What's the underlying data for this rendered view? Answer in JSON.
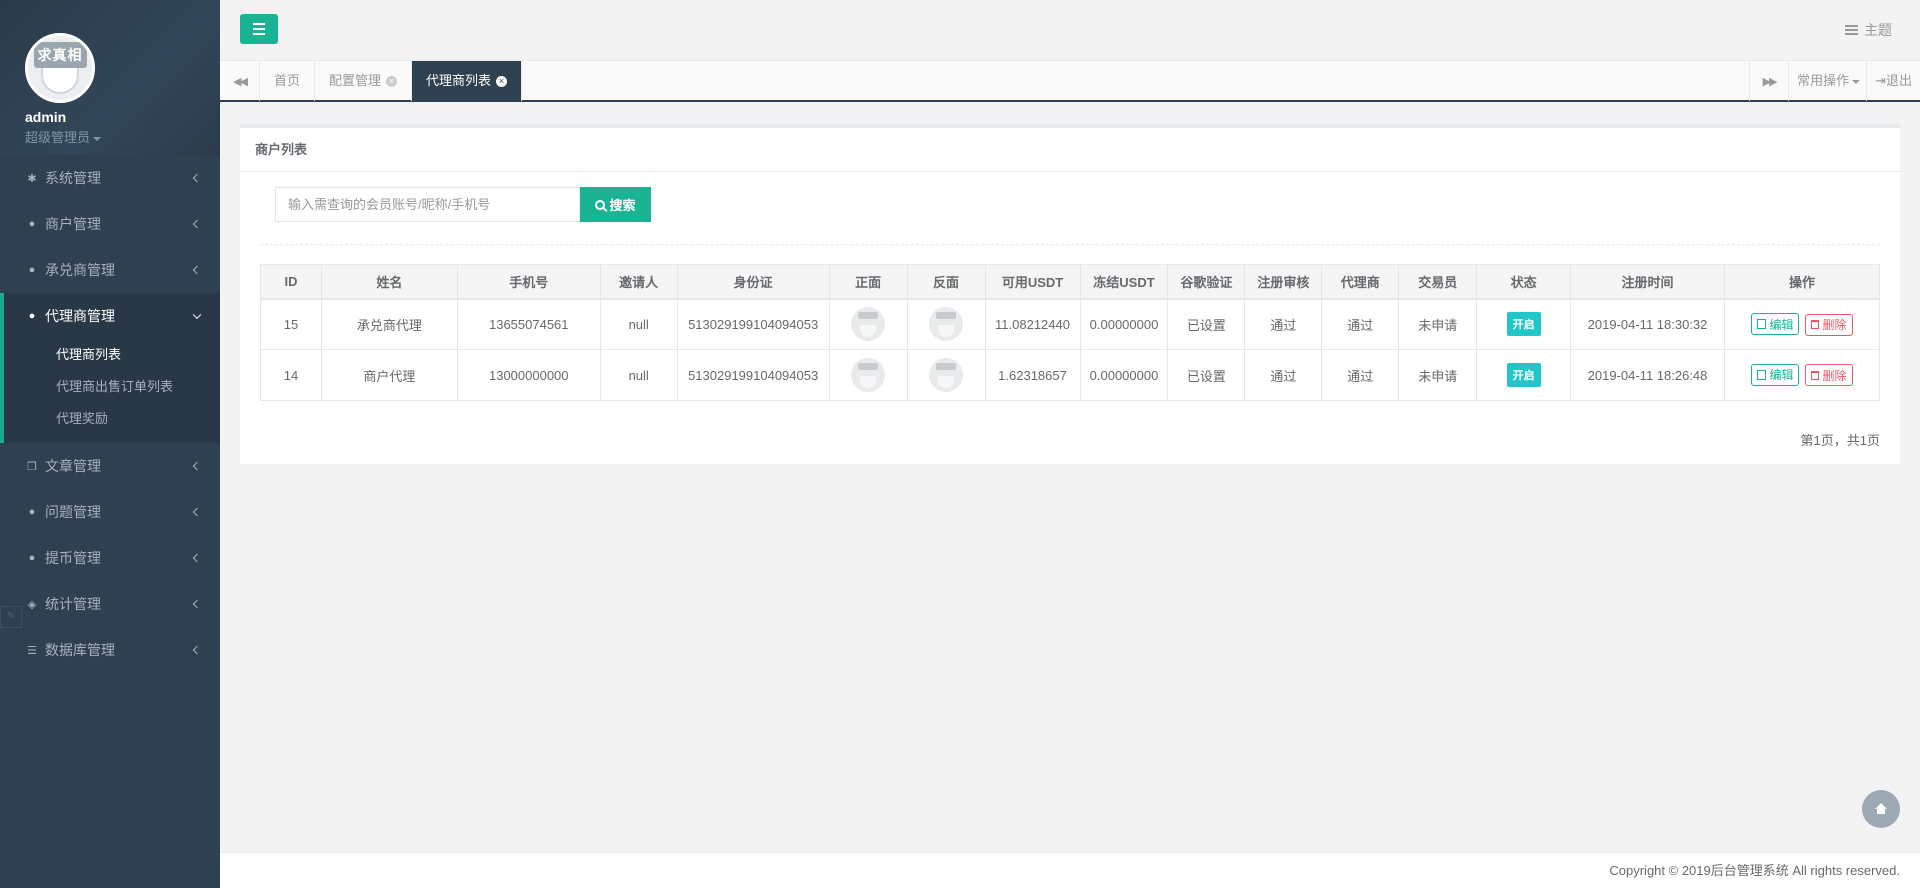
{
  "profile": {
    "avatar_text": "求真相",
    "name": "admin",
    "role": "超级管理员"
  },
  "menu": {
    "system": "系统管理",
    "merchant": "商户管理",
    "acceptor": "承兑商管理",
    "agent": "代理商管理",
    "agent_sub": [
      "代理商列表",
      "代理商出售订单列表",
      "代理奖励"
    ],
    "article": "文章管理",
    "question": "问题管理",
    "withdraw": "提币管理",
    "stats": "统计管理",
    "database": "数据库管理"
  },
  "topbar": {
    "theme_label": "主题"
  },
  "tabs": {
    "home": "首页",
    "config": "配置管理",
    "current": "代理商列表",
    "common_ops": "常用操作",
    "logout": "退出"
  },
  "panel": {
    "title": "商户列表",
    "search_placeholder": "输入需查询的会员账号/昵称/手机号",
    "search_button": "搜索"
  },
  "table": {
    "headers": [
      "ID",
      "姓名",
      "手机号",
      "邀请人",
      "身份证",
      "正面",
      "反面",
      "可用USDT",
      "冻结USDT",
      "谷歌验证",
      "注册审核",
      "代理商",
      "交易员",
      "状态",
      "注册时间",
      "操作"
    ],
    "rows": [
      {
        "id": "15",
        "name": "承兑商代理",
        "phone": "13655074561",
        "inviter": "null",
        "idcard": "513029199104094053",
        "available": "11.08212440",
        "frozen": "0.00000000",
        "google": "已设置",
        "review": "通过",
        "agent": "通过",
        "trader": "未申请",
        "status": "开启",
        "time": "2019-04-11 18:30:32",
        "edit": "编辑",
        "delete": "删除"
      },
      {
        "id": "14",
        "name": "商户代理",
        "phone": "13000000000",
        "inviter": "null",
        "idcard": "513029199104094053",
        "available": "1.62318657",
        "frozen": "0.00000000",
        "google": "已设置",
        "review": "通过",
        "agent": "通过",
        "trader": "未申请",
        "status": "开启",
        "time": "2019-04-11 18:26:48",
        "edit": "编辑",
        "delete": "删除"
      }
    ]
  },
  "pager": "第1页，共1页",
  "footer": "Copyright © 2019后台管理系统 All rights reserved.",
  "colors": {
    "sidebar": "#2f4050",
    "accent": "#1ab394",
    "status_on": "#23c6c8",
    "danger": "#ed5565"
  }
}
